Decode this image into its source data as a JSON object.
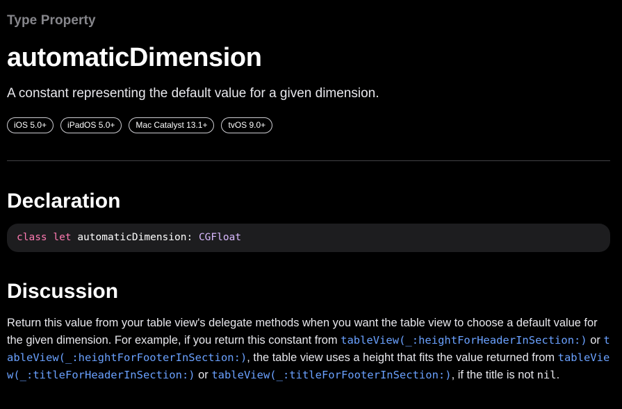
{
  "header": {
    "eyebrow": "Type Property",
    "title": "automaticDimension",
    "abstract": "A constant representing the default value for a given dimension."
  },
  "availability": [
    {
      "label": "iOS 5.0+"
    },
    {
      "label": "iPadOS 5.0+"
    },
    {
      "label": "Mac Catalyst 13.1+"
    },
    {
      "label": "tvOS 9.0+"
    }
  ],
  "declaration": {
    "heading": "Declaration",
    "keyword1": "class",
    "keyword2": "let",
    "name": "automaticDimension",
    "colon": ":",
    "type": "CGFloat"
  },
  "discussion": {
    "heading": "Discussion",
    "text1": "Return this value from your table view's delegate methods when you want the table view to choose a default value for the given dimension. For example, if you return this constant from ",
    "link1": "tableView(_:heightForHeaderInSection:)",
    "text2": " or ",
    "link2": "tableView(_:heightForFooterInSection:)",
    "text3": ", the table view uses a height that fits the value returned from ",
    "link3": "tableView(_:titleForHeaderInSection:)",
    "text4": " or ",
    "link4": "tableView(_:titleForFooterInSection:)",
    "text5": ", if the title is not ",
    "code1": "nil",
    "text6": "."
  },
  "colors": {
    "background": "#000000",
    "keyword": "#ff7ab2",
    "type": "#dabaff",
    "link": "#6aa1ff",
    "secondary_text": "#86868b"
  }
}
